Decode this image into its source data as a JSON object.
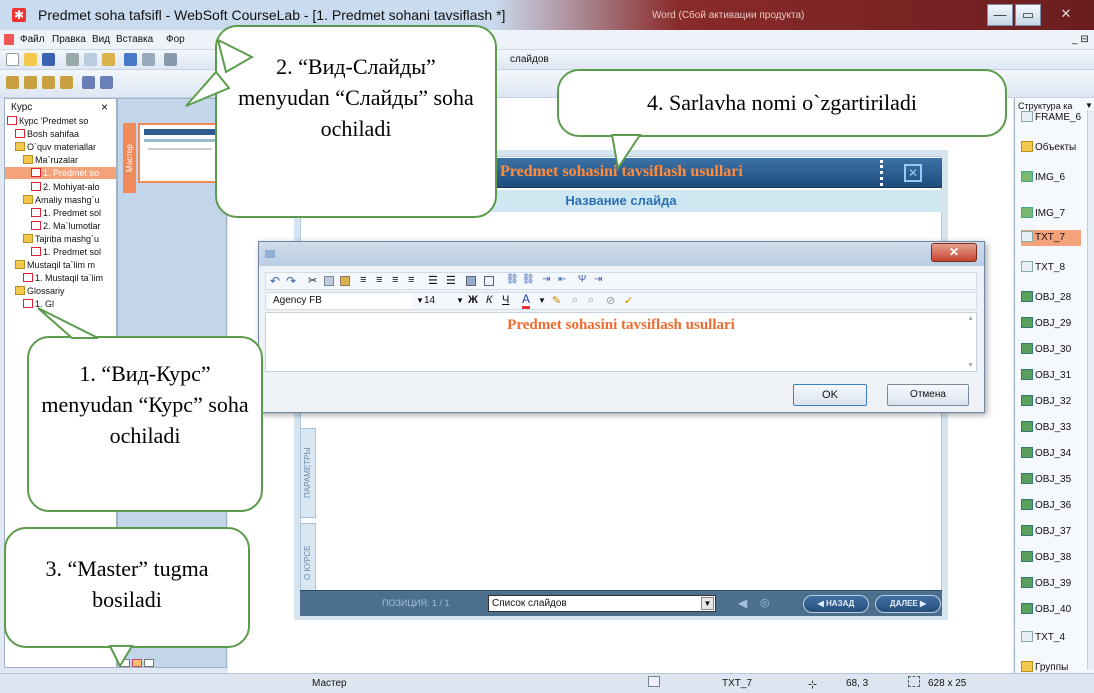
{
  "window": {
    "title": "Predmet soha tafsifl - WebSoft CourseLab - [1. Predmet sohani tavsiflash *]",
    "ghost_text": "Word (Сбой активации продукта)",
    "controls": {
      "minimize": "—",
      "restore": "▭",
      "close": "✕"
    }
  },
  "menu": {
    "items": [
      "Файл",
      "Правка",
      "Вид",
      "Вставка",
      "Фор"
    ],
    "right_control": "_ ⊟"
  },
  "toolbar": {
    "slides_label": "слайдов"
  },
  "course_panel": {
    "title": "Курс",
    "close": "×",
    "items": [
      {
        "label": "Курс 'Predmet so",
        "type": "doc",
        "level": 0
      },
      {
        "label": "Bosh sahifaa",
        "type": "doc",
        "level": 1
      },
      {
        "label": "O`quv materiallar",
        "type": "folder",
        "level": 1
      },
      {
        "label": "Ma`ruzalar",
        "type": "folder",
        "level": 2
      },
      {
        "label": "1. Predmet so",
        "type": "doc",
        "level": 3,
        "selected": true
      },
      {
        "label": "2. Mohiyat-alo",
        "type": "doc",
        "level": 3
      },
      {
        "label": "Amaliy mashg`u",
        "type": "folder",
        "level": 2
      },
      {
        "label": "1. Predmet sol",
        "type": "doc",
        "level": 3
      },
      {
        "label": "2. Ma`lumotlar",
        "type": "doc",
        "level": 3
      },
      {
        "label": "Tajriba mashg`u",
        "type": "folder",
        "level": 2
      },
      {
        "label": "1. Predmet sol",
        "type": "doc",
        "level": 3
      },
      {
        "label": "Mustaqil ta`lim m",
        "type": "folder",
        "level": 1
      },
      {
        "label": "1. Mustaqil ta`lim",
        "type": "doc",
        "level": 2
      },
      {
        "label": "Glossariy",
        "type": "folder",
        "level": 1
      },
      {
        "label": "1. Gl",
        "type": "doc",
        "level": 2
      }
    ]
  },
  "thumbnails": {
    "master_tab": "Мастер"
  },
  "slide": {
    "title": "Predmet sohasini tavsiflash usullari",
    "subtitle": "Название слайда",
    "side_tabs": [
      "ПАРАМЕТРЫ",
      "О КУРСЕ"
    ],
    "position_label": "ПОЗИЦИЯ: 1 / 1",
    "slide_list": "Список слайдов",
    "back": "НАЗАД",
    "next": "ДАЛЕЕ"
  },
  "dialog": {
    "font_name": "Agency FB",
    "font_size": "14",
    "text": "Predmet sohasini tavsiflash usullari",
    "ok": "OK",
    "cancel": "Отмена",
    "close": "✕"
  },
  "structure_panel": {
    "title": "Структура ка",
    "items": [
      {
        "label": "FRAME_6",
        "icon": "frame"
      },
      {
        "label": "Объекты",
        "icon": "folder"
      },
      {
        "label": "IMG_6",
        "icon": "image"
      },
      {
        "label": "IMG_7",
        "icon": "image"
      },
      {
        "label": "TXT_7",
        "icon": "text",
        "selected": true
      },
      {
        "label": "TXT_8",
        "icon": "text"
      },
      {
        "label": "OBJ_28",
        "icon": "object"
      },
      {
        "label": "OBJ_29",
        "icon": "object"
      },
      {
        "label": "OBJ_30",
        "icon": "object"
      },
      {
        "label": "OBJ_31",
        "icon": "object"
      },
      {
        "label": "OBJ_32",
        "icon": "object"
      },
      {
        "label": "OBJ_33",
        "icon": "object"
      },
      {
        "label": "OBJ_34",
        "icon": "object"
      },
      {
        "label": "OBJ_35",
        "icon": "object"
      },
      {
        "label": "OBJ_36",
        "icon": "object"
      },
      {
        "label": "OBJ_37",
        "icon": "object"
      },
      {
        "label": "OBJ_38",
        "icon": "object"
      },
      {
        "label": "OBJ_39",
        "icon": "object"
      },
      {
        "label": "OBJ_40",
        "icon": "object"
      },
      {
        "label": "TXT_4",
        "icon": "text"
      },
      {
        "label": "Группы",
        "icon": "folder"
      }
    ]
  },
  "status": {
    "mode": "Мастер",
    "object": "TXT_7",
    "position": "68, 3",
    "size": "628 x 25"
  },
  "callouts": {
    "c1": "1. “Вид-Курс” menyudan “Курс” soha ochiladi",
    "c2": "2. “Вид-Слайды” menyudan “Слайды” soha ochiladi",
    "c3": "3. “Master” tugma bosiladi",
    "c4": "4. Sarlavha nomi o`zgartiriladi"
  },
  "colors": {
    "accent_orange": "#f26a2e",
    "slide_title_bg": "#2b5d8e",
    "slide_subtitle": "#2b6fb3",
    "callout_border": "#5d9b4c"
  }
}
